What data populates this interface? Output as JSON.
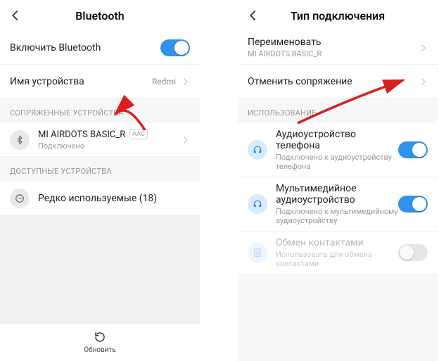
{
  "left": {
    "title": "Bluetooth",
    "toggle_label": "Включить Bluetooth",
    "toggle_on": true,
    "device_name_label": "Имя устройства",
    "device_name_value": "Redmi",
    "paired_header": "СОПРЯЖЕННЫЕ УСТРОЙСТВА",
    "paired_device": {
      "name": "MI AIRDOTS BASIC_R",
      "badge": "AAC",
      "status": "Подключено"
    },
    "available_header": "ДОСТУПНЫЕ УСТРОЙСТВА",
    "rare_label": "Редко используемые (18)",
    "refresh_label": "Обновить"
  },
  "right": {
    "title": "Тип подключения",
    "rename_label": "Переименовать",
    "rename_sub": "MI AIRDOTS BASIC_R",
    "unpair_label": "Отменить сопряжение",
    "usage_header": "ИСПОЛЬЗОВАНИЕ",
    "audio_phone": {
      "title": "Аудиоустройство телефона",
      "sub": "Подключено к аудиоустройству телефона",
      "on": true
    },
    "audio_media": {
      "title": "Мультимедийное аудиоустройство",
      "sub": "Подключено к мультимедийному аудиоустройству",
      "on": true
    },
    "contacts": {
      "title": "Обмен контактами",
      "sub": "Использовать для обмена контактами",
      "on": false
    }
  }
}
